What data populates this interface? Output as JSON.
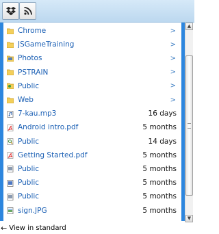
{
  "toolbar": {
    "tabs": [
      {
        "icon": "dropbox-icon"
      },
      {
        "icon": "rss-icon"
      }
    ]
  },
  "files": [
    {
      "name": "Chrome",
      "type": "folder",
      "meta": ">"
    },
    {
      "name": "JSGameTraining",
      "type": "folder",
      "meta": ">"
    },
    {
      "name": "Photos",
      "type": "folder-photos",
      "meta": ">"
    },
    {
      "name": "PSTRAIN",
      "type": "folder",
      "meta": ">"
    },
    {
      "name": "Public",
      "type": "folder-public",
      "meta": ">"
    },
    {
      "name": "Web",
      "type": "folder",
      "meta": ">"
    },
    {
      "name": "7-kau.mp3",
      "type": "audio",
      "meta": "16 days"
    },
    {
      "name": "Android intro.pdf",
      "type": "pdf",
      "meta": "5 months"
    },
    {
      "name": "Public",
      "type": "search",
      "meta": "14 days"
    },
    {
      "name": "Getting Started.pdf",
      "type": "pdf",
      "meta": "5 months"
    },
    {
      "name": "Public",
      "type": "doc",
      "meta": "5 months"
    },
    {
      "name": "Public",
      "type": "doc-blue",
      "meta": "5 months"
    },
    {
      "name": "Public",
      "type": "doc",
      "meta": "5 months"
    },
    {
      "name": "sign.JPG",
      "type": "image",
      "meta": "5 months"
    }
  ],
  "footer": {
    "label": "View in standard"
  },
  "colors": {
    "accent": "#2d86de",
    "link": "#1a5fb4",
    "folder": "#f3cf5a"
  }
}
